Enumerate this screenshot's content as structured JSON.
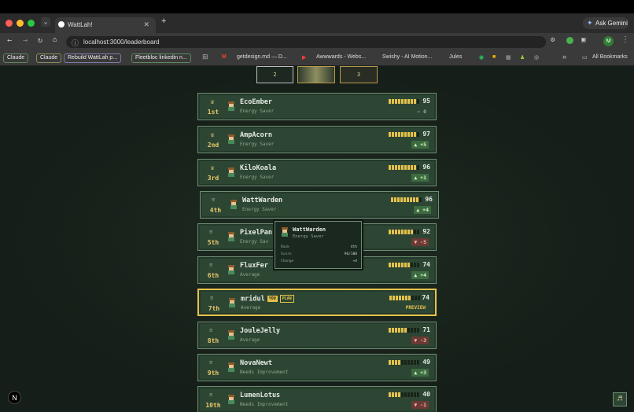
{
  "browser": {
    "tab_title": "WattLah!",
    "url": "localhost:3000/leaderboard",
    "ask_gemini": "Ask Gemini",
    "profile_initial": "M",
    "bookmarks": [
      "Claude",
      "Claude",
      "Rebuild WattLah p...",
      "Fleetbloc linkedin n...",
      "getdesign.md — D...",
      "Awwwards - Webs...",
      "Swishy - AI Motion...",
      "Jules",
      "All Bookmarks"
    ]
  },
  "podium": [
    "2",
    "",
    "3"
  ],
  "rows": [
    {
      "rank": "1st",
      "name": "EcoEmber",
      "tier": "Energy Saver",
      "score": "95",
      "bar_fraction": 0.95,
      "change": "0",
      "change_type": "flat",
      "medal": true
    },
    {
      "rank": "2nd",
      "name": "AmpAcorn",
      "tier": "Energy Saver",
      "score": "97",
      "bar_fraction": 0.97,
      "change": "+5",
      "change_type": "up",
      "medal": true
    },
    {
      "rank": "3rd",
      "name": "KiloKoala",
      "tier": "Energy Saver",
      "score": "96",
      "bar_fraction": 0.96,
      "change": "+1",
      "change_type": "up",
      "medal": true
    },
    {
      "rank": "4th",
      "name": "WattWarden",
      "tier": "Energy Saver",
      "score": "96",
      "bar_fraction": 0.96,
      "change": "+4",
      "change_type": "up"
    },
    {
      "rank": "5th",
      "name": "PixelPan",
      "tier": "Energy Sav",
      "score": "92",
      "bar_fraction": 0.92,
      "change": "-5",
      "change_type": "down"
    },
    {
      "rank": "6th",
      "name": "FluxFer",
      "tier": "Average",
      "score": "74",
      "bar_fraction": 0.74,
      "change": "+4",
      "change_type": "up"
    },
    {
      "rank": "7th",
      "name": "mridul",
      "tier": "Average",
      "score": "74",
      "bar_fraction": 0.74,
      "change": "PREVIEW",
      "change_type": "preview",
      "you": true,
      "you_label": "YOU",
      "plan_label": "PLAN"
    },
    {
      "rank": "8th",
      "name": "JouleJelly",
      "tier": "Average",
      "score": "71",
      "bar_fraction": 0.71,
      "change": "-3",
      "change_type": "down"
    },
    {
      "rank": "9th",
      "name": "NovaNewt",
      "tier": "Needs Improvement",
      "score": "49",
      "bar_fraction": 0.49,
      "change": "+3",
      "change_type": "up"
    },
    {
      "rank": "10th",
      "name": "LumenLotus",
      "tier": "Needs Improvement",
      "score": "40",
      "bar_fraction": 0.4,
      "change": "-1",
      "change_type": "down"
    }
  ],
  "tooltip": {
    "name": "WattWarden",
    "tier": "Energy Saver",
    "rank_label": "Rank",
    "rank_value": "4th",
    "score_label": "Score",
    "score_value": "96/100",
    "change_label": "Change",
    "change_value": "+4"
  },
  "colors": {
    "accent": "#e6c24b",
    "panel": "#2d4634",
    "up": "#3d6b40",
    "down": "#6b3a34"
  }
}
